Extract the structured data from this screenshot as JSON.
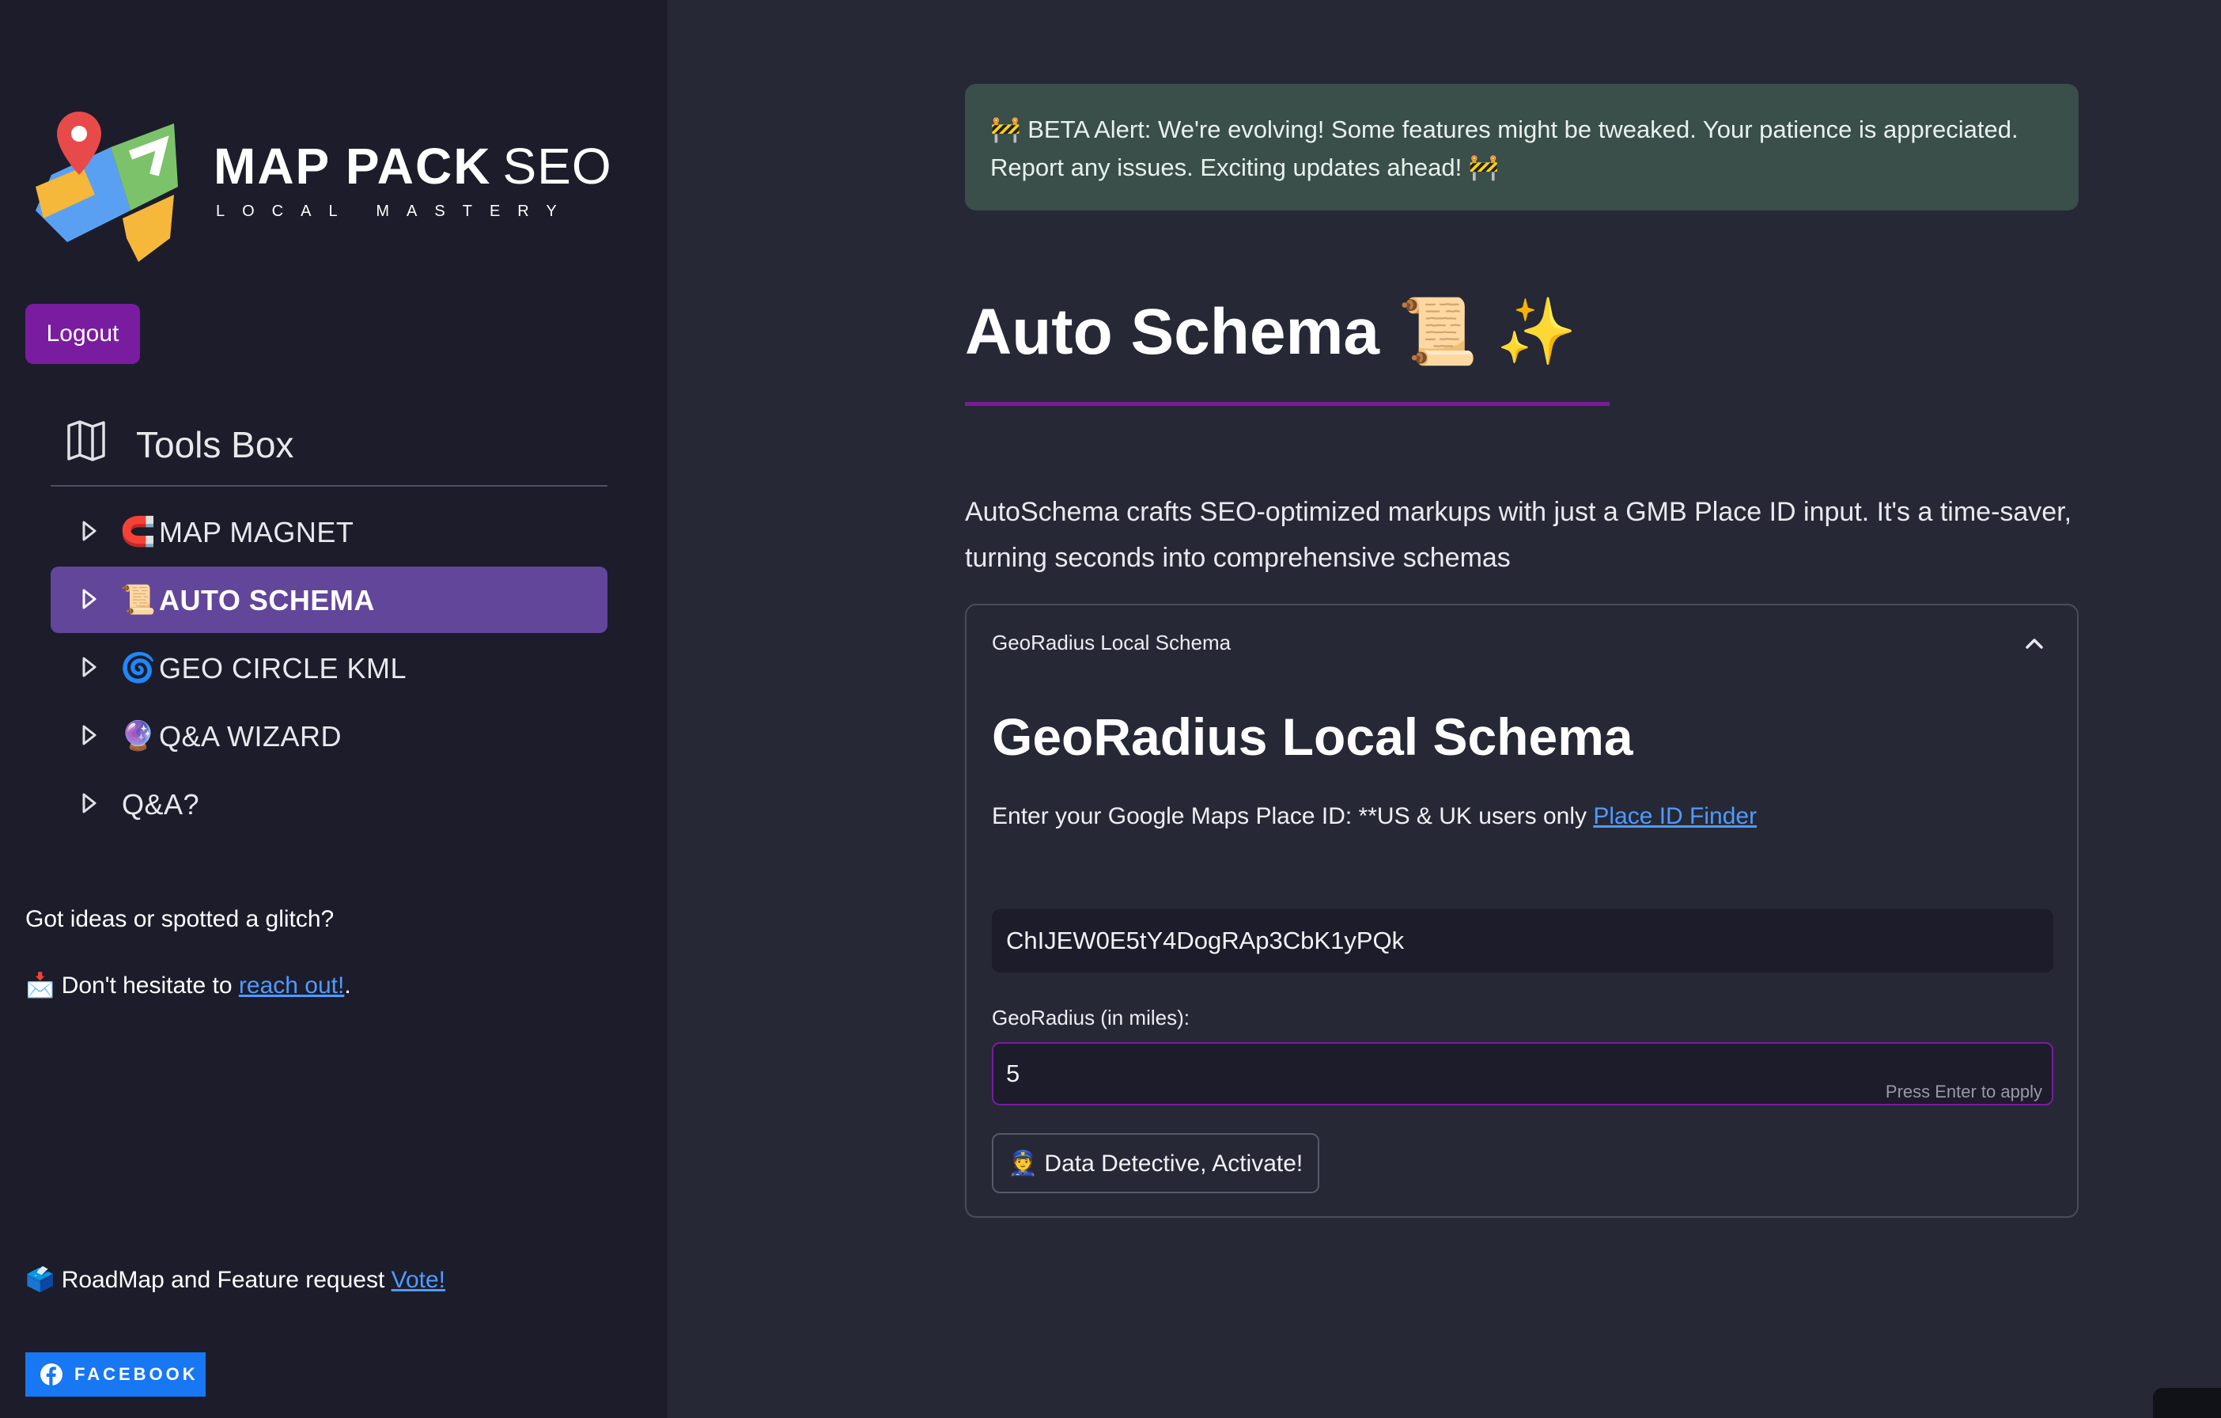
{
  "brand": {
    "name_bold": "MAP PACK",
    "name_light": "SEO",
    "tagline": "LOCAL MASTERY",
    "colors": {
      "red": "#e84a4a",
      "yellow": "#f5b83a",
      "blue": "#5aa0f2",
      "green": "#7cc26a"
    }
  },
  "sidebar": {
    "logout_label": "Logout",
    "toolsbox_title": "Tools Box",
    "items": [
      {
        "emoji": "🧲",
        "label": "MAP MAGNET",
        "active": false
      },
      {
        "emoji": "📜",
        "label": "AUTO SCHEMA",
        "active": true
      },
      {
        "emoji": "🌀",
        "label": "GEO CIRCLE KML",
        "active": false
      },
      {
        "emoji": "🔮",
        "label": "Q&A WIZARD",
        "active": false
      },
      {
        "emoji": "",
        "label": "Q&A?",
        "active": false
      }
    ],
    "feedback_text": "Got ideas or spotted a glitch?",
    "reach_prefix": "📩 Don't hesitate to ",
    "reach_link": "reach out!",
    "reach_suffix": ".",
    "roadmap_prefix": "🗳️ RoadMap and Feature request ",
    "roadmap_link": "Vote!",
    "facebook_label": "FACEBOOK"
  },
  "main": {
    "beta_alert": "🚧 BETA Alert: We're evolving! Some features might be tweaked. Your patience is appreciated. Report any issues. Exciting updates ahead! 🚧",
    "title": "Auto Schema 📜 ✨",
    "description": "AutoSchema crafts SEO-optimized markups with just a GMB Place ID input. It's a time-saver, turning seconds into comprehensive schemas",
    "panel": {
      "header": "GeoRadius Local Schema",
      "heading": "GeoRadius Local Schema",
      "place_id_label": "Enter your Google Maps Place ID: **US & UK users only ",
      "place_id_link": "Place ID Finder",
      "place_id_value": "ChIJEW0E5tY4DogRAp3CbK1yPQk",
      "radius_label": "GeoRadius (in miles):",
      "radius_value": "5",
      "enter_hint": "Press Enter to apply",
      "activate_label": "👮 Data Detective, Activate!"
    }
  },
  "theme": {
    "accent": "#7a1ca0",
    "active_nav": "#62469a",
    "alert_bg": "#3a4e4a",
    "link": "#4f9bff"
  }
}
